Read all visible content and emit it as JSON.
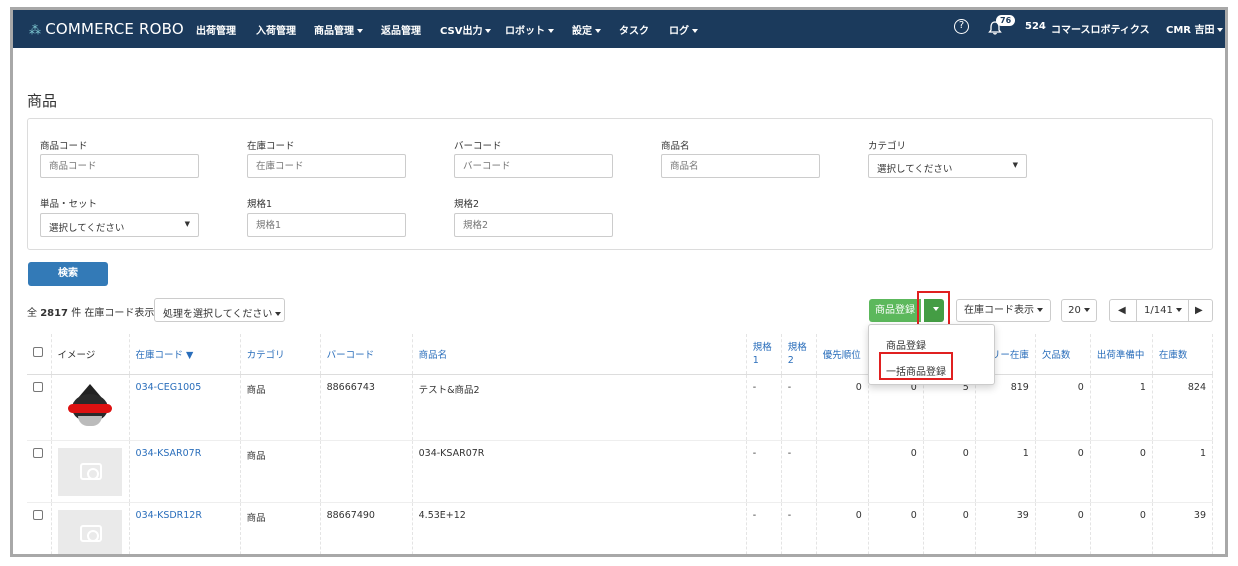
{
  "brand": {
    "logo_text": "COMMERCE ROBO",
    "mark": "⁂"
  },
  "nav": {
    "items": [
      {
        "label": "出荷管理",
        "caret": false
      },
      {
        "label": "入荷管理",
        "caret": false
      },
      {
        "label": "商品管理",
        "caret": true
      },
      {
        "label": "返品管理",
        "caret": false
      },
      {
        "label": "CSV出力",
        "caret": true
      },
      {
        "label": "ロボット",
        "caret": true
      },
      {
        "label": "設定",
        "caret": true
      },
      {
        "label": "タスク",
        "caret": false
      },
      {
        "label": "ログ",
        "caret": true
      }
    ],
    "notification_count": "76",
    "company_code": "524",
    "company_name": "コマースロボティクス",
    "user": "CMR 吉田"
  },
  "page": {
    "title": "商品"
  },
  "filters": {
    "product_code": {
      "label": "商品コード",
      "placeholder": "商品コード"
    },
    "stock_code": {
      "label": "在庫コード",
      "placeholder": "在庫コード"
    },
    "barcode": {
      "label": "バーコード",
      "placeholder": "バーコード"
    },
    "product_name": {
      "label": "商品名",
      "placeholder": "商品名"
    },
    "category": {
      "label": "カテゴリ",
      "value": "選択してください"
    },
    "single_set": {
      "label": "単品・セット",
      "value": "選択してください"
    },
    "spec1": {
      "label": "規格1",
      "placeholder": "規格1"
    },
    "spec2": {
      "label": "規格2",
      "placeholder": "規格2"
    }
  },
  "search_button": "検索",
  "summary": {
    "prefix": "全",
    "count": "2817",
    "suffix": "件 在庫コード表示"
  },
  "bulk_action": "処理を選択してください",
  "toolbar": {
    "register_label": "商品登録",
    "display_toggle": "在庫コード表示",
    "per_page": "20",
    "page_indicator": "1/141"
  },
  "register_menu": {
    "items": [
      "商品登録",
      "一括商品登録"
    ]
  },
  "table": {
    "headers": {
      "image": "イメージ",
      "stock_code": "在庫コード ▼",
      "category": "カテゴリ",
      "barcode": "バーコード",
      "name": "商品名",
      "spec1_a": "規格",
      "spec1_b": "1",
      "spec2_a": "規格",
      "spec2_b": "2",
      "priority": "優先順位",
      "col_a": "",
      "col_b": "",
      "free_stock": "リー在庫",
      "shortage": "欠品数",
      "preparing": "出荷準備中",
      "stock": "在庫数"
    },
    "rows": [
      {
        "image": "mascot",
        "stock_code": "034-CEG1005",
        "category": "商品",
        "barcode": "88666743",
        "name": "テスト&商品2",
        "spec1": "-",
        "spec2": "-",
        "priority": "0",
        "col_a": "0",
        "col_b": "5",
        "free_stock": "819",
        "shortage": "0",
        "preparing": "1",
        "stock": "824"
      },
      {
        "image": "placeholder",
        "stock_code": "034-KSAR07R",
        "category": "商品",
        "barcode": "",
        "name": "034-KSAR07R",
        "spec1": "-",
        "spec2": "-",
        "priority": "",
        "col_a": "0",
        "col_b": "0",
        "free_stock": "1",
        "shortage": "0",
        "preparing": "0",
        "stock": "1"
      },
      {
        "image": "placeholder",
        "stock_code": "034-KSDR12R",
        "category": "商品",
        "barcode": "88667490",
        "name": "4.53E+12",
        "spec1": "-",
        "spec2": "-",
        "priority": "0",
        "col_a": "0",
        "col_b": "0",
        "free_stock": "39",
        "shortage": "0",
        "preparing": "0",
        "stock": "39"
      }
    ]
  }
}
